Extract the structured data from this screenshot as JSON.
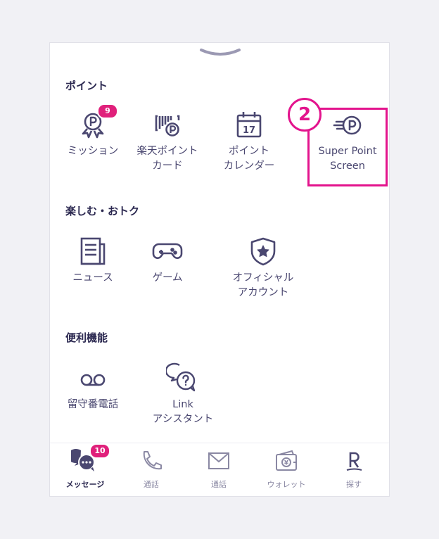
{
  "sections": {
    "points": {
      "title": "ポイント"
    },
    "fun": {
      "title": "楽しむ・おトク"
    },
    "utility": {
      "title": "便利機能"
    }
  },
  "items": {
    "mission": {
      "label": "ミッション",
      "badge": "9"
    },
    "pointcard": {
      "label": "楽天ポイント\nカード"
    },
    "calendar": {
      "label": "ポイント\nカレンダー",
      "day": "17"
    },
    "superpoint": {
      "label": "Super Point\nScreen"
    },
    "news": {
      "label": "ニュース"
    },
    "game": {
      "label": "ゲーム"
    },
    "official": {
      "label": "オフィシャル\nアカウント"
    },
    "voicemail": {
      "label": "留守番電話"
    },
    "link": {
      "label": "Link\nアシスタント"
    }
  },
  "annotation": {
    "step": "2"
  },
  "tabs": [
    {
      "label": "メッセージ",
      "badge": "10",
      "icon": "chat-icon"
    },
    {
      "label": "通話",
      "icon": "phone-icon"
    },
    {
      "label": "通話",
      "icon": "mail-icon"
    },
    {
      "label": "ウォレット",
      "icon": "wallet-icon"
    },
    {
      "label": "探す",
      "icon": "rakuten-r-icon"
    }
  ],
  "colors": {
    "accent": "#e3148d",
    "badge": "#e0207b",
    "icon": "#4a4770"
  }
}
